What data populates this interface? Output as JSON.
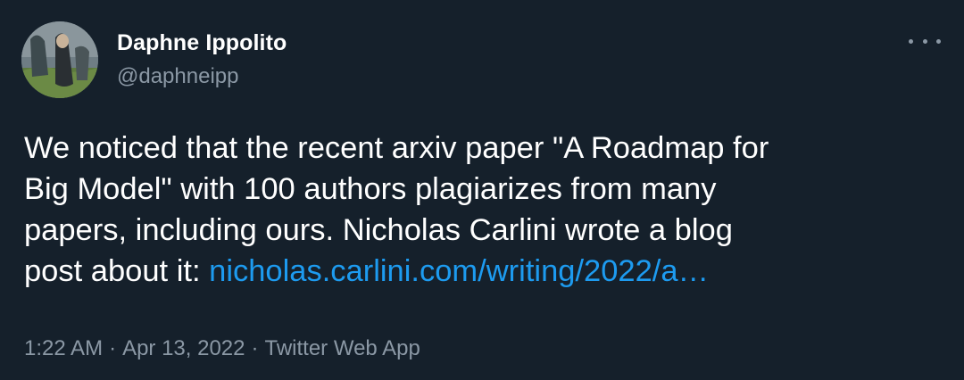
{
  "author": {
    "display_name": "Daphne Ippolito",
    "handle": "@daphneipp"
  },
  "menu_icon": "more-horizontal-icon",
  "avatar_icon": "avatar-photo",
  "tweet": {
    "text_lines": [
      "We noticed that the recent arxiv paper \"A Roadmap for",
      "Big Model\" with 100 authors plagiarizes from many",
      "papers, including ours. Nicholas Carlini wrote a blog"
    ],
    "last_line_prefix": "post about it: ",
    "link_text": "nicholas.carlini.com/writing/2022/a…"
  },
  "meta": {
    "time": "1:22 AM",
    "separator": "·",
    "date": "Apr 13, 2022",
    "source": "Twitter Web App"
  },
  "colors": {
    "background": "#15202b",
    "text": "#ffffff",
    "secondary": "#8b98a5",
    "link": "#1d9bf0"
  }
}
